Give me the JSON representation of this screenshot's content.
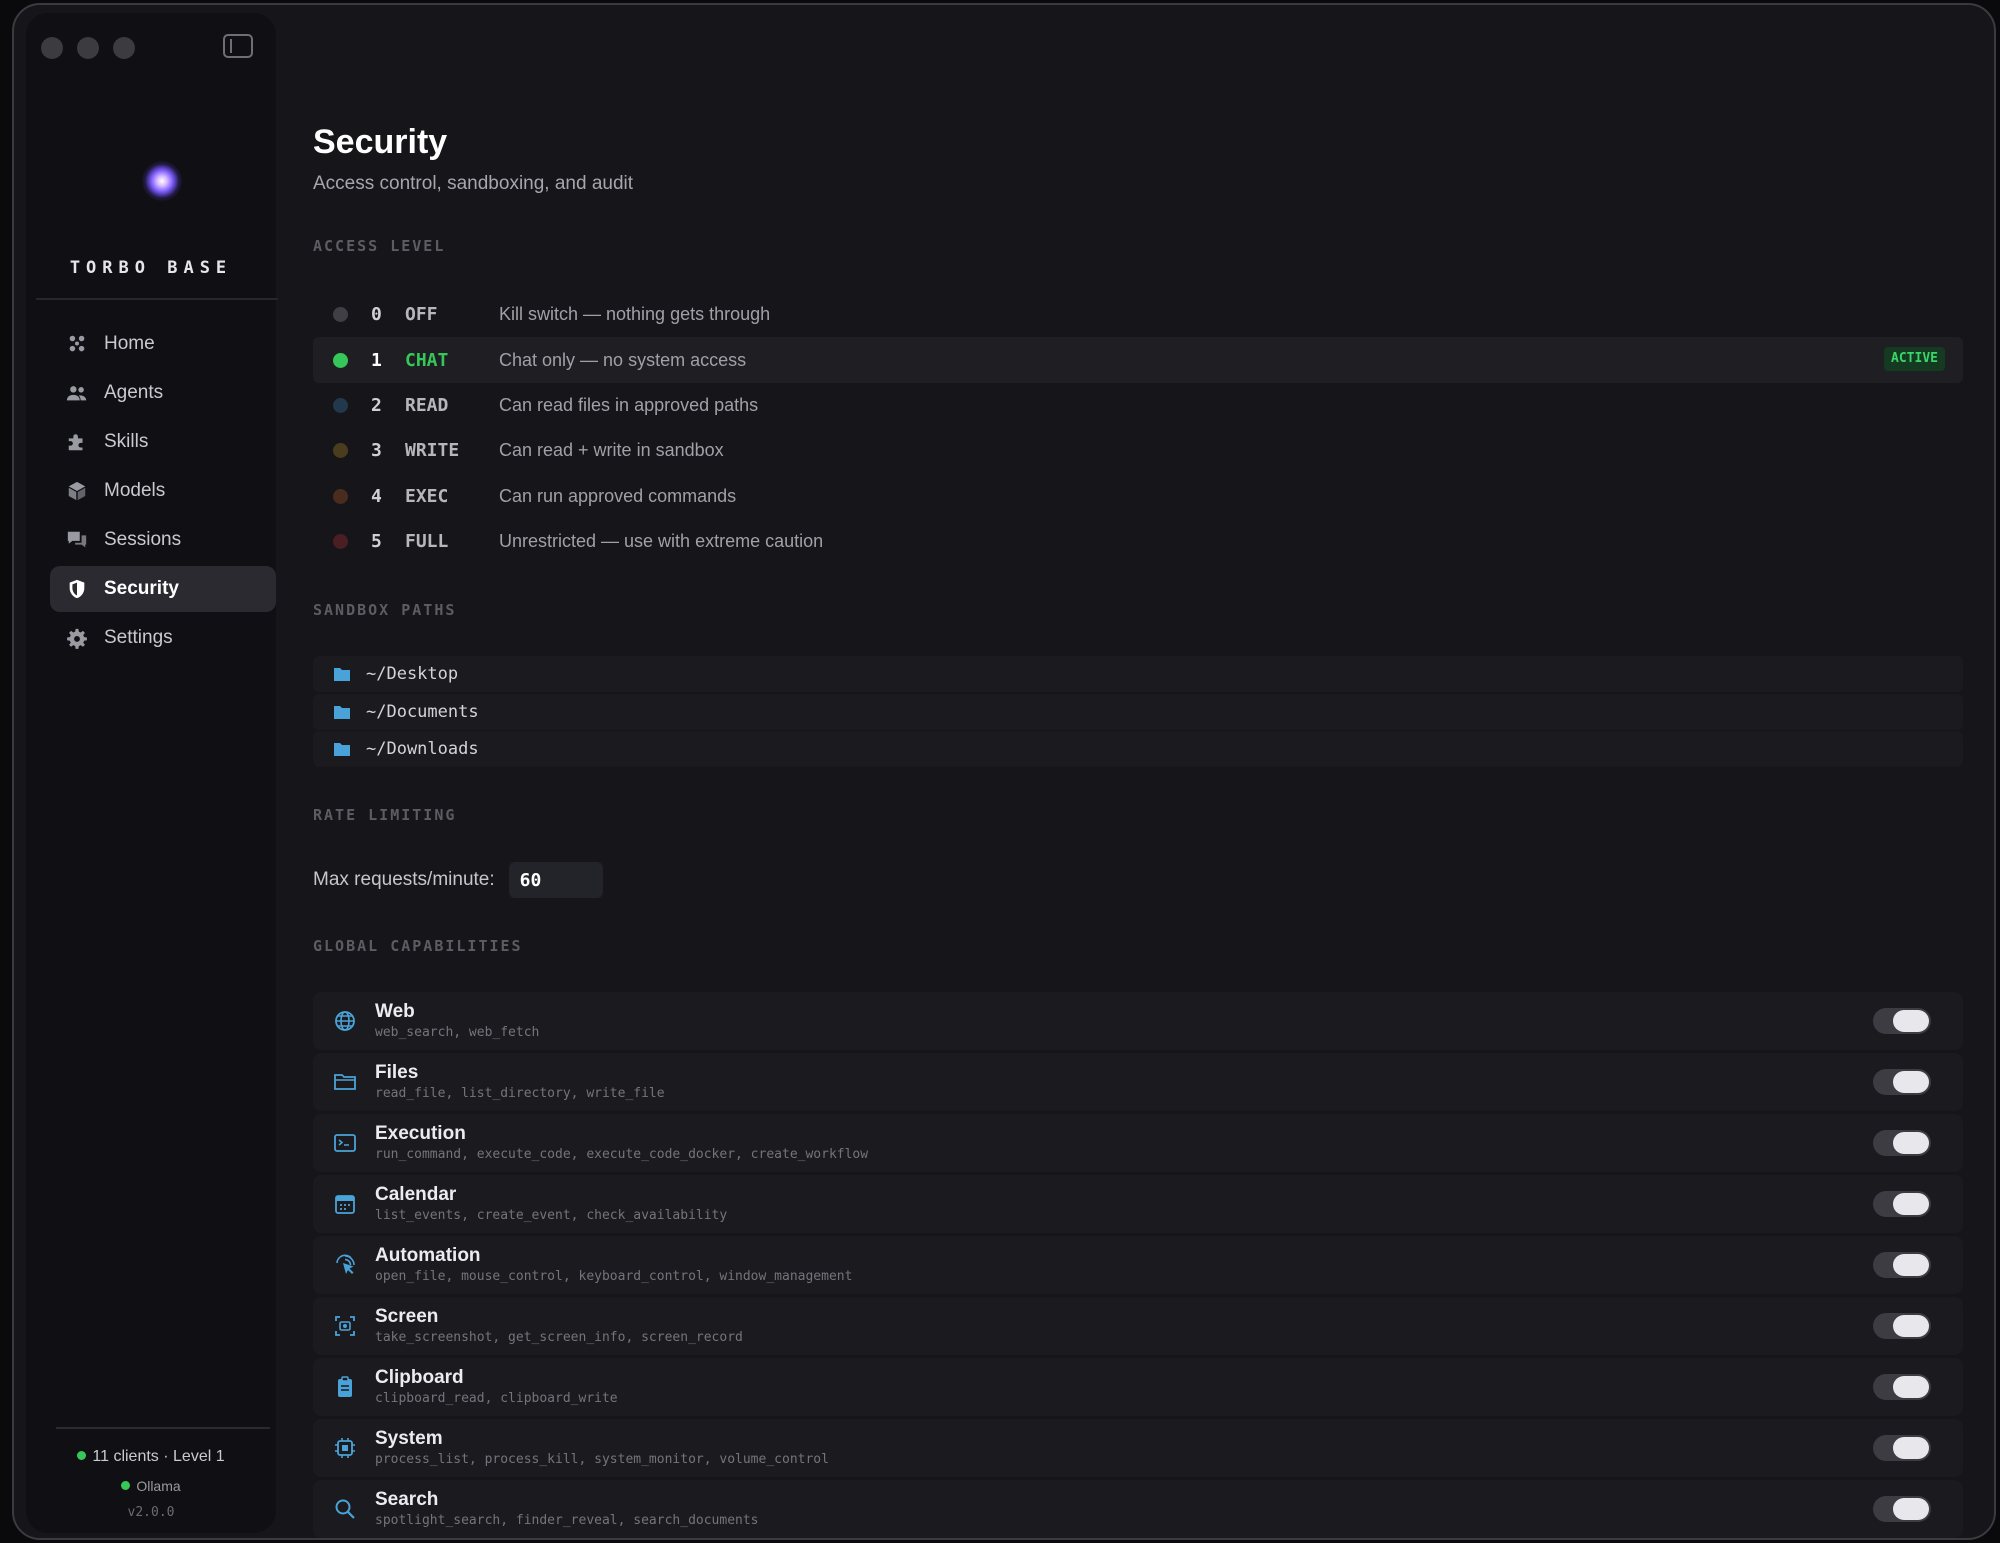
{
  "sidebar": {
    "brand": "TORBO BASE",
    "nav": [
      {
        "label": "Home",
        "icon": "home-icon",
        "active": false
      },
      {
        "label": "Agents",
        "icon": "agents-icon",
        "active": false
      },
      {
        "label": "Skills",
        "icon": "puzzle-icon",
        "active": false
      },
      {
        "label": "Models",
        "icon": "cube-icon",
        "active": false
      },
      {
        "label": "Sessions",
        "icon": "chat-bubbles-icon",
        "active": false
      },
      {
        "label": "Security",
        "icon": "shield-icon",
        "active": true
      },
      {
        "label": "Settings",
        "icon": "gear-icon",
        "active": false
      }
    ],
    "status": "11 clients · Level 1",
    "ollama": "Ollama",
    "version": "v2.0.0"
  },
  "page": {
    "title": "Security",
    "subtitle": "Access control, sandboxing, and audit"
  },
  "access": {
    "label": "ACCESS LEVEL",
    "levels": [
      {
        "num": "0",
        "name": "OFF",
        "desc": "Kill switch — nothing gets through",
        "color": "#3f3f45"
      },
      {
        "num": "1",
        "name": "CHAT",
        "desc": "Chat only — no system access",
        "color": "#35c759",
        "badge": "ACTIVE"
      },
      {
        "num": "2",
        "name": "READ",
        "desc": "Can read files in approved paths",
        "color": "#22384c"
      },
      {
        "num": "3",
        "name": "WRITE",
        "desc": "Can read + write in sandbox",
        "color": "#4a3d1e"
      },
      {
        "num": "4",
        "name": "EXEC",
        "desc": "Can run approved commands",
        "color": "#4a2c1e"
      },
      {
        "num": "5",
        "name": "FULL",
        "desc": "Unrestricted — use with extreme caution",
        "color": "#4a1e22"
      }
    ]
  },
  "sandbox": {
    "label": "SANDBOX PATHS",
    "paths": [
      "~/Desktop",
      "~/Documents",
      "~/Downloads"
    ]
  },
  "rate": {
    "label": "RATE LIMITING",
    "field_label": "Max requests/minute:",
    "value": "60"
  },
  "capabilities": {
    "label": "GLOBAL CAPABILITIES",
    "items": [
      {
        "name": "Web",
        "tools": "web_search, web_fetch",
        "icon": "globe-icon",
        "enabled": true
      },
      {
        "name": "Files",
        "tools": "read_file, list_directory, write_file",
        "icon": "folder-icon",
        "enabled": true
      },
      {
        "name": "Execution",
        "tools": "run_command, execute_code, execute_code_docker, create_workflow",
        "icon": "terminal-icon",
        "enabled": true
      },
      {
        "name": "Calendar",
        "tools": "list_events, create_event, check_availability",
        "icon": "calendar-icon",
        "enabled": true
      },
      {
        "name": "Automation",
        "tools": "open_file, mouse_control, keyboard_control, window_management",
        "icon": "pointer-icon",
        "enabled": true
      },
      {
        "name": "Screen",
        "tools": "take_screenshot, get_screen_info, screen_record",
        "icon": "camera-icon",
        "enabled": true
      },
      {
        "name": "Clipboard",
        "tools": "clipboard_read, clipboard_write",
        "icon": "clipboard-icon",
        "enabled": true
      },
      {
        "name": "System",
        "tools": "process_list, process_kill, system_monitor, volume_control",
        "icon": "cpu-icon",
        "enabled": true
      },
      {
        "name": "Search",
        "tools": "spotlight_search, finder_reveal, search_documents",
        "icon": "search-icon",
        "enabled": true
      }
    ]
  }
}
